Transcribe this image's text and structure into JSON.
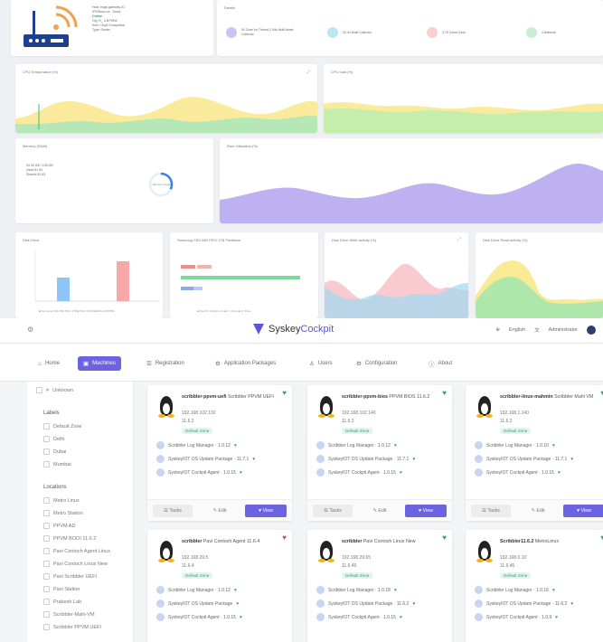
{
  "dashboard": {
    "device": {
      "lines": [
        "Host: edge-gateway-01",
        "IPS/Bocc ua · Scout",
        "Online",
        "Cfg: R_ 4.B.PMW",
        "Kern: Oxy4 Kompanisk",
        "Type: Router"
      ],
      "status_color": "#2ca56a"
    },
    "details": {
      "title": "Details",
      "stats": [
        {
          "text": "50 Zone for Thread 2 Xits Multi Asset Collector",
          "color": "#c9c2f5"
        },
        {
          "text": "32.44 Multi Collector",
          "color": "#b9e8f2"
        },
        {
          "text": "3.76 Cores Zone",
          "color": "#f8d0d0"
        },
        {
          "text": "4 Network",
          "color": "#c9efd3"
        }
      ]
    },
    "cpu_temp": {
      "title": "CPU Temperature (%)"
    },
    "cpu_load": {
      "title": "CPU load (%)"
    },
    "memory": {
      "title": "Memory (RAM)",
      "rows": [
        "94.33 GB / 128 GB",
        "Used 51.53",
        "Shared 51.53"
      ],
      "gauge_label": "Memory Usage",
      "gauge_value": 0.32
    },
    "ram_util": {
      "title": "Ram Utilization (%)"
    },
    "disk_size": {
      "title": "Disk Drive",
      "legend": "■ Samsung SSD 860 PRO 1TB  ■ WDC WD20EZRX-00D8PB0"
    },
    "disk_samsung": {
      "title": "Samsung SSD 860 PRO 1TB Partitions",
      "legend": "■ Disk #0, Partition #1  ■ C:\\ Drive   ■ D:\\ Drive"
    },
    "disk_activity": {
      "title": "Disk Drive Write activity (%)"
    },
    "disk_read": {
      "title": "Disk Drive Read activity (%)"
    }
  },
  "app": {
    "brand_a": "Syskey",
    "brand_b": "Cockpit",
    "language": "English",
    "user": "Administrator",
    "tabs": [
      {
        "label": "Home",
        "icon": "⌂"
      },
      {
        "label": "Machines",
        "icon": "▣"
      },
      {
        "label": "Registration",
        "icon": "☰"
      },
      {
        "label": "Application Packages",
        "icon": "⚙"
      },
      {
        "label": "Users",
        "icon": "♙"
      },
      {
        "label": "Configuration",
        "icon": "⚙"
      },
      {
        "label": "About",
        "icon": "ⓘ"
      }
    ],
    "sidebar": {
      "top_item": "Unknown",
      "labels_head": "Labels",
      "labels": [
        "Default Zone",
        "Delhi",
        "Dubai",
        "Mumbai"
      ],
      "locations_head": "Locations",
      "locations": [
        "Metro Linux",
        "Metro Station",
        "PPVM AD",
        "PPVM BOOI 11.6.2",
        "Pavi Contoch Agent Linux",
        "Pavi Contoch Linux New",
        "Pavi Scribbler UEFI",
        "Pavi Station",
        "Prabesh Lab",
        "Scribbler-Mahi-VM",
        "Scribbler PPVM UEFI"
      ]
    },
    "machines": [
      {
        "name": "scribbler-ppvm-uefi",
        "desc": "Scribbler PPVM UEFI",
        "ip": "192.168.102.102",
        "ver": "11.6.2",
        "zone": "Default Zone",
        "status": "ok",
        "pkgs": [
          "Scribbler Log Manager · 1.0.12",
          "SyskeyIOT OS Update Package · 11.7.1",
          "SyskeyIOT Cockpit Agent · 1.0.15"
        ]
      },
      {
        "name": "scribbler-ppvm-bios",
        "desc": "PPVM BIOS 11.6.2",
        "ip": "192.168.102.140",
        "ver": "11.6.2",
        "zone": "Default Zone",
        "status": "ok",
        "pkgs": [
          "Scribbler Log Manager · 1.0.12",
          "SyskeyIOT OS Update Package · 11.7.1",
          "SyskeyIOT Cockpit Agent · 1.0.15"
        ]
      },
      {
        "name": "scribbler-linux-mahmin",
        "desc": "Scribbler Mahi VM",
        "ip": "192.168.1.140",
        "ver": "11.6.2",
        "zone": "Default Zone",
        "status": "ok",
        "pkgs": [
          "Scribbler Log Manager · 1.0.10",
          "SyskeyIOT OS Update Package · 11.7.1",
          "SyskeyIOT Cockpit Agent · 1.0.15"
        ]
      },
      {
        "name": "scribbler",
        "desc": "Pavi Contoch Agent 11.6.4",
        "ip": "192.168.29.5",
        "ver": "11.6.4",
        "zone": "Default Zone",
        "status": "warn",
        "pkgs": [
          "Scribbler Log Manager · 1.0.12",
          "SyskeyIOT OS Update Package",
          "SyskeyIOT Cockpit Agent · 1.0.15"
        ]
      },
      {
        "name": "scribbler",
        "desc": "Pavi Contoch Linux New",
        "ip": "192.168.29.65",
        "ver": "11.6.45",
        "zone": "Default Zone",
        "status": "ok",
        "pkgs": [
          "Scribbler Log Manager · 1.0.18",
          "SyskeyIOT OS Update Package · 11.6.2",
          "SyskeyIOT Cockpit Agent · 1.0.15"
        ]
      },
      {
        "name": "Scribbler11.6.2",
        "desc": "MetroLinux",
        "ip": "192.168.0.10",
        "ver": "11.6.45",
        "zone": "Default Zone",
        "status": "ok",
        "pkgs": [
          "Scribbler Log Manager · 1.0.16",
          "SyskeyIOT OS Update Package · 11.6.2",
          "SyskeyIOT Cockpit Agent · 1.0.9"
        ]
      }
    ],
    "actions": {
      "tasks": "Tasks",
      "edit": "Edit",
      "view": "View"
    }
  }
}
